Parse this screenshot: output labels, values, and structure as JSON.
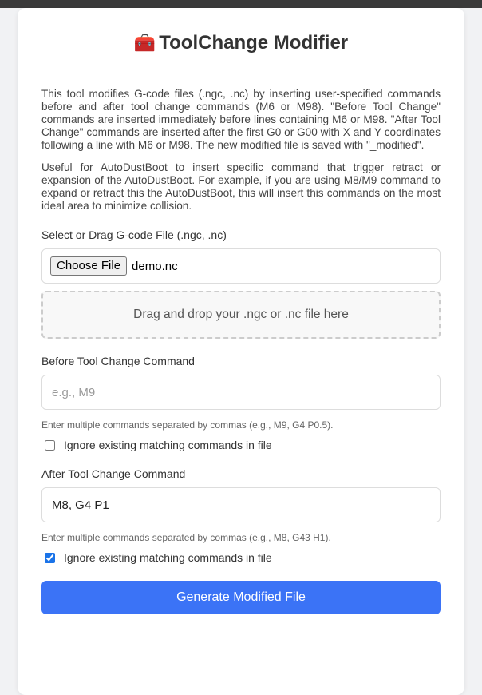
{
  "app": {
    "title_icon": "toolbox-icon",
    "title_emoji": "🧰",
    "title": "ToolChange Modifier"
  },
  "description": {
    "p1": "This tool modifies G-code files (.ngc, .nc) by inserting user-specified commands before and after tool change commands (M6 or M98). \"Before Tool Change\" commands are inserted immediately before lines containing M6 or M98. \"After Tool Change\" commands are inserted after the first G0 or G00 with X and Y coordinates following a line with M6 or M98. The new modified file is saved with \"_modified\".",
    "p2": "Useful for AutoDustBoot to insert specific command that trigger retract or expansion of the AutoDustBoot. For example, if you are using M8/M9 command to expand or retract this the AutoDustBoot, this will insert this commands on the most ideal area to minimize collision."
  },
  "file": {
    "label": "Select or Drag G-code File (.ngc, .nc)",
    "button_label": "Choose File",
    "file_name": "demo.nc",
    "dropzone_text": "Drag and drop your .ngc or .nc file here"
  },
  "before": {
    "label": "Before Tool Change Command",
    "value": "",
    "placeholder": "e.g., M9",
    "hint": "Enter multiple commands separated by commas (e.g., M9, G4 P0.5).",
    "ignore_label": "Ignore existing matching commands in file",
    "ignore_checked": false
  },
  "after": {
    "label": "After Tool Change Command",
    "value": "M8, G4 P1",
    "placeholder": "",
    "hint": "Enter multiple commands separated by commas (e.g., M8, G43 H1).",
    "ignore_label": "Ignore existing matching commands in file",
    "ignore_checked": true
  },
  "actions": {
    "generate_label": "Generate Modified File"
  },
  "colors": {
    "accent": "#3b73f6",
    "top_bar": "#3a3a3a",
    "background": "#f1f2f4"
  }
}
